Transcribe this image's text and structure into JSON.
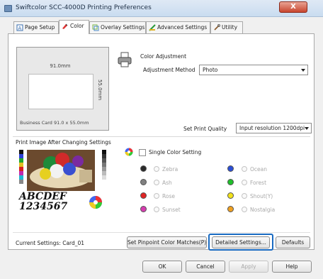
{
  "window": {
    "title": "Swiftcolor SCC-4000D Printing Preferences",
    "close_label": "X"
  },
  "tabs": [
    {
      "label": "Page Setup",
      "icon": "page-setup-icon"
    },
    {
      "label": "Color",
      "icon": "color-icon"
    },
    {
      "label": "Overlay Settings",
      "icon": "overlay-icon"
    },
    {
      "label": "Advanced Settings",
      "icon": "advanced-icon"
    },
    {
      "label": "Utility",
      "icon": "utility-icon"
    }
  ],
  "active_tab": "Color",
  "preview": {
    "width_label": "91.0mm",
    "height_label": "55.0mm",
    "size_label": "Business Card 91.0 x 55.0mm"
  },
  "color_adjustment": {
    "heading": "Color Adjustment",
    "method_label": "Adjustment Method",
    "method_value": "Photo"
  },
  "print_quality": {
    "label": "Set Print Quality",
    "value": "Input resolution 1200dpi"
  },
  "print_image_label": "Print Image After Changing Settings",
  "print_image_text": [
    "ABCDEF",
    "1234567"
  ],
  "single_color": {
    "label": "Single Color Setting",
    "checked": false,
    "options": [
      {
        "label": "Zebra",
        "color": "#2a2a2a"
      },
      {
        "label": "Ocean",
        "color": "#2b4fd6"
      },
      {
        "label": "Ash",
        "color": "#808080"
      },
      {
        "label": "Forest",
        "color": "#1fbf2a"
      },
      {
        "label": "Rose",
        "color": "#e02424"
      },
      {
        "label": "Shout(Y)",
        "color": "#f2e21a"
      },
      {
        "label": "Sunset",
        "color": "#d63cb0"
      },
      {
        "label": "Nostalgia",
        "color": "#f0a020"
      }
    ]
  },
  "current_settings": "Current Settings: Card_01",
  "buttons": {
    "set_pinpoint": "Set Pinpoint Color Matches(P)",
    "detailed": "Detailed Settings...",
    "defaults": "Defaults",
    "ok": "OK",
    "cancel": "Cancel",
    "apply": "Apply",
    "help": "Help"
  },
  "colors": {
    "accent_highlight": "#1a6bc2",
    "close": "#c8452e"
  }
}
